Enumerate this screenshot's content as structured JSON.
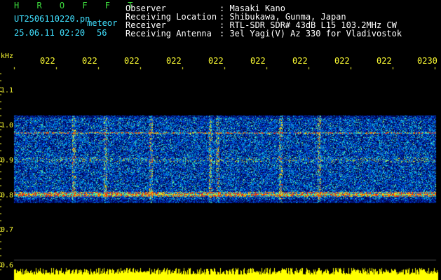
{
  "header": {
    "brand": "H R O F F T",
    "filename": "UT2506110220.pn",
    "mode": "meteor",
    "datetime": "25.06.11 02:20",
    "count": "56",
    "info_labels": [
      "Observer",
      "Receiving Location",
      "Receiver",
      "Receiving Antenna"
    ],
    "info_values": [
      ": Masaki Kano",
      ": Shibukawa, Gunma, Japan",
      ": RTL-SDR SDR# 43dB L15 103.2MHz CW",
      ": 3el Yagi(V) Az 330 for Vladivostok"
    ]
  },
  "axis": {
    "unit": "kHz",
    "y_ticks": [
      "1.1",
      "1.0",
      "0.9",
      "0.8",
      "0.7",
      "0.6"
    ],
    "x_ticks": [
      "022",
      "022",
      "022",
      "022",
      "022",
      "022",
      "022",
      "022",
      "022",
      "0230"
    ]
  },
  "colors": {
    "background": "#000000",
    "noise_blue": "#1030c0",
    "signal_cyan": "#40e0ff",
    "carrier_red": "#ff3000",
    "activity_yellow": "#ffff00"
  }
}
